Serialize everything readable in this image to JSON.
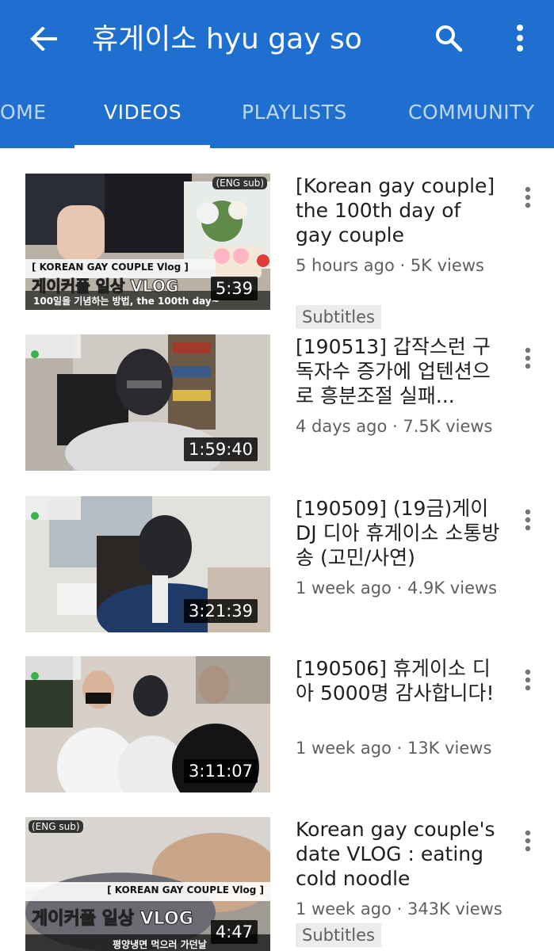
{
  "header": {
    "title": "휴게이소 hyu gay so",
    "back_icon": "arrow-back-icon",
    "search_icon": "search-icon",
    "more_icon": "more-vert-icon",
    "bg_color": "#1f6fd0"
  },
  "tabs": [
    {
      "label": "OME",
      "active": false
    },
    {
      "label": "VIDEOS",
      "active": true
    },
    {
      "label": "PLAYLISTS",
      "active": false
    },
    {
      "label": "COMMUNITY",
      "active": false
    }
  ],
  "videos": [
    {
      "title": "[Korean gay couple] the 100th day of gay couple",
      "meta": "5 hours ago · 5K views",
      "badge": "Subtitles",
      "duration": "5:39",
      "thumb_text": {
        "corner": "(ENG sub)",
        "tag": "[ KOREAN GAY COUPLE Vlog ]",
        "main": "게이커플 일상 VLOG",
        "sub": "100일을 기념하는 방법, the 100th day~"
      }
    },
    {
      "title": "[190513] 갑작스런 구독자수 증가에 업텐션으로 흥분조절 실패...",
      "meta": "4 days ago · 7.5K views",
      "badge": "",
      "duration": "1:59:40"
    },
    {
      "title": "[190509] (19금)게이 DJ 디아 휴게이소 소통방송 (고민/사연)",
      "meta": "1 week ago · 4.9K views",
      "badge": "",
      "duration": "3:21:39"
    },
    {
      "title": "[190506] 휴게이소 디아 5000명 감사합니다!",
      "meta": "1 week ago · 13K views",
      "badge": "",
      "duration": "3:11:07"
    },
    {
      "title": "Korean gay couple's date VLOG : eating cold noodle",
      "meta": "1 week ago · 343K views",
      "badge": "Subtitles",
      "duration": "4:47",
      "thumb_text": {
        "corner": "(ENG sub)",
        "tag": "[ KOREAN GAY COUPLE Vlog ]",
        "main": "게이커플 일상 VLOG",
        "sub": "평양냉면 먹으러 가던날"
      }
    }
  ]
}
